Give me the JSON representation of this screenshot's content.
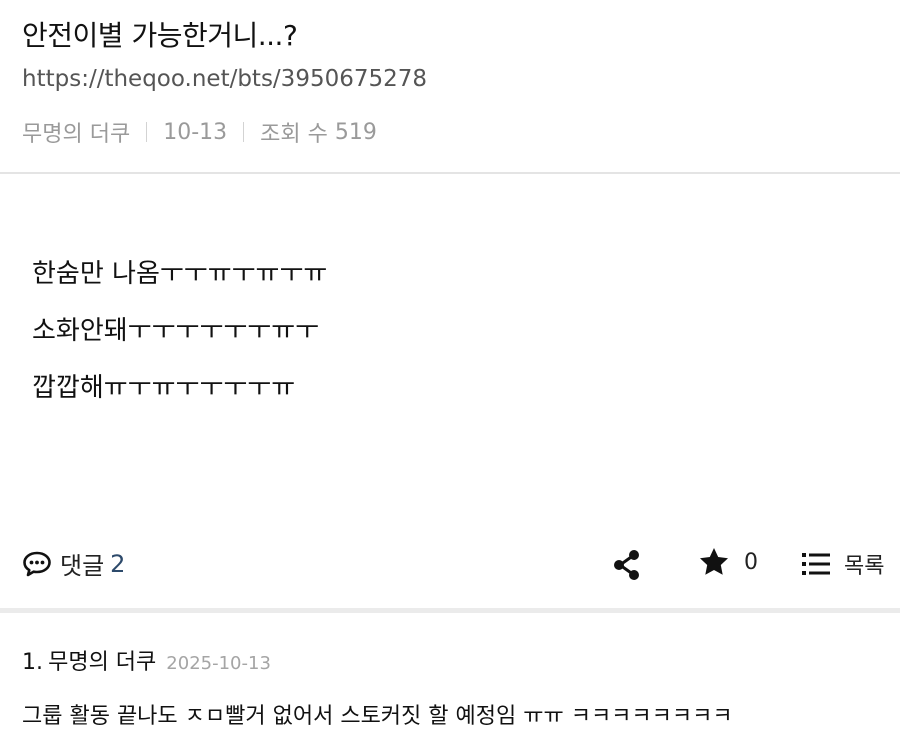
{
  "post": {
    "title": "안전이별 가능한거니...?",
    "url": "https://theqoo.net/bts/3950675278",
    "author": "무명의 더쿠",
    "date": "10-13",
    "views_label": "조회 수",
    "views": "519",
    "body_lines": [
      "한숨만 나옴ㅜㅜㅠㅜㅠㅜㅠ",
      "소화안돼ㅜㅜㅜㅜㅜㅜㅠㅜ",
      "깝깝해ㅠㅜㅠㅜㅜㅜㅜㅠ"
    ]
  },
  "actions": {
    "comment_icon": "speech-bubble-icon",
    "comment_label": "댓글",
    "comment_count": "2",
    "share_icon": "share-icon",
    "favorite_icon": "star-icon",
    "favorite_count": "0",
    "list_icon": "list-icon",
    "list_label": "목록"
  },
  "comments": [
    {
      "number": "1.",
      "author": "무명의 더쿠",
      "date": "2025-10-13",
      "text": "그룹 활동 끝나도 ㅈㅁ빨거 없어서 스토커짓 할 예정임 ㅠㅠ ㅋㅋㅋㅋㅋㅋㅋㅋ"
    }
  ]
}
